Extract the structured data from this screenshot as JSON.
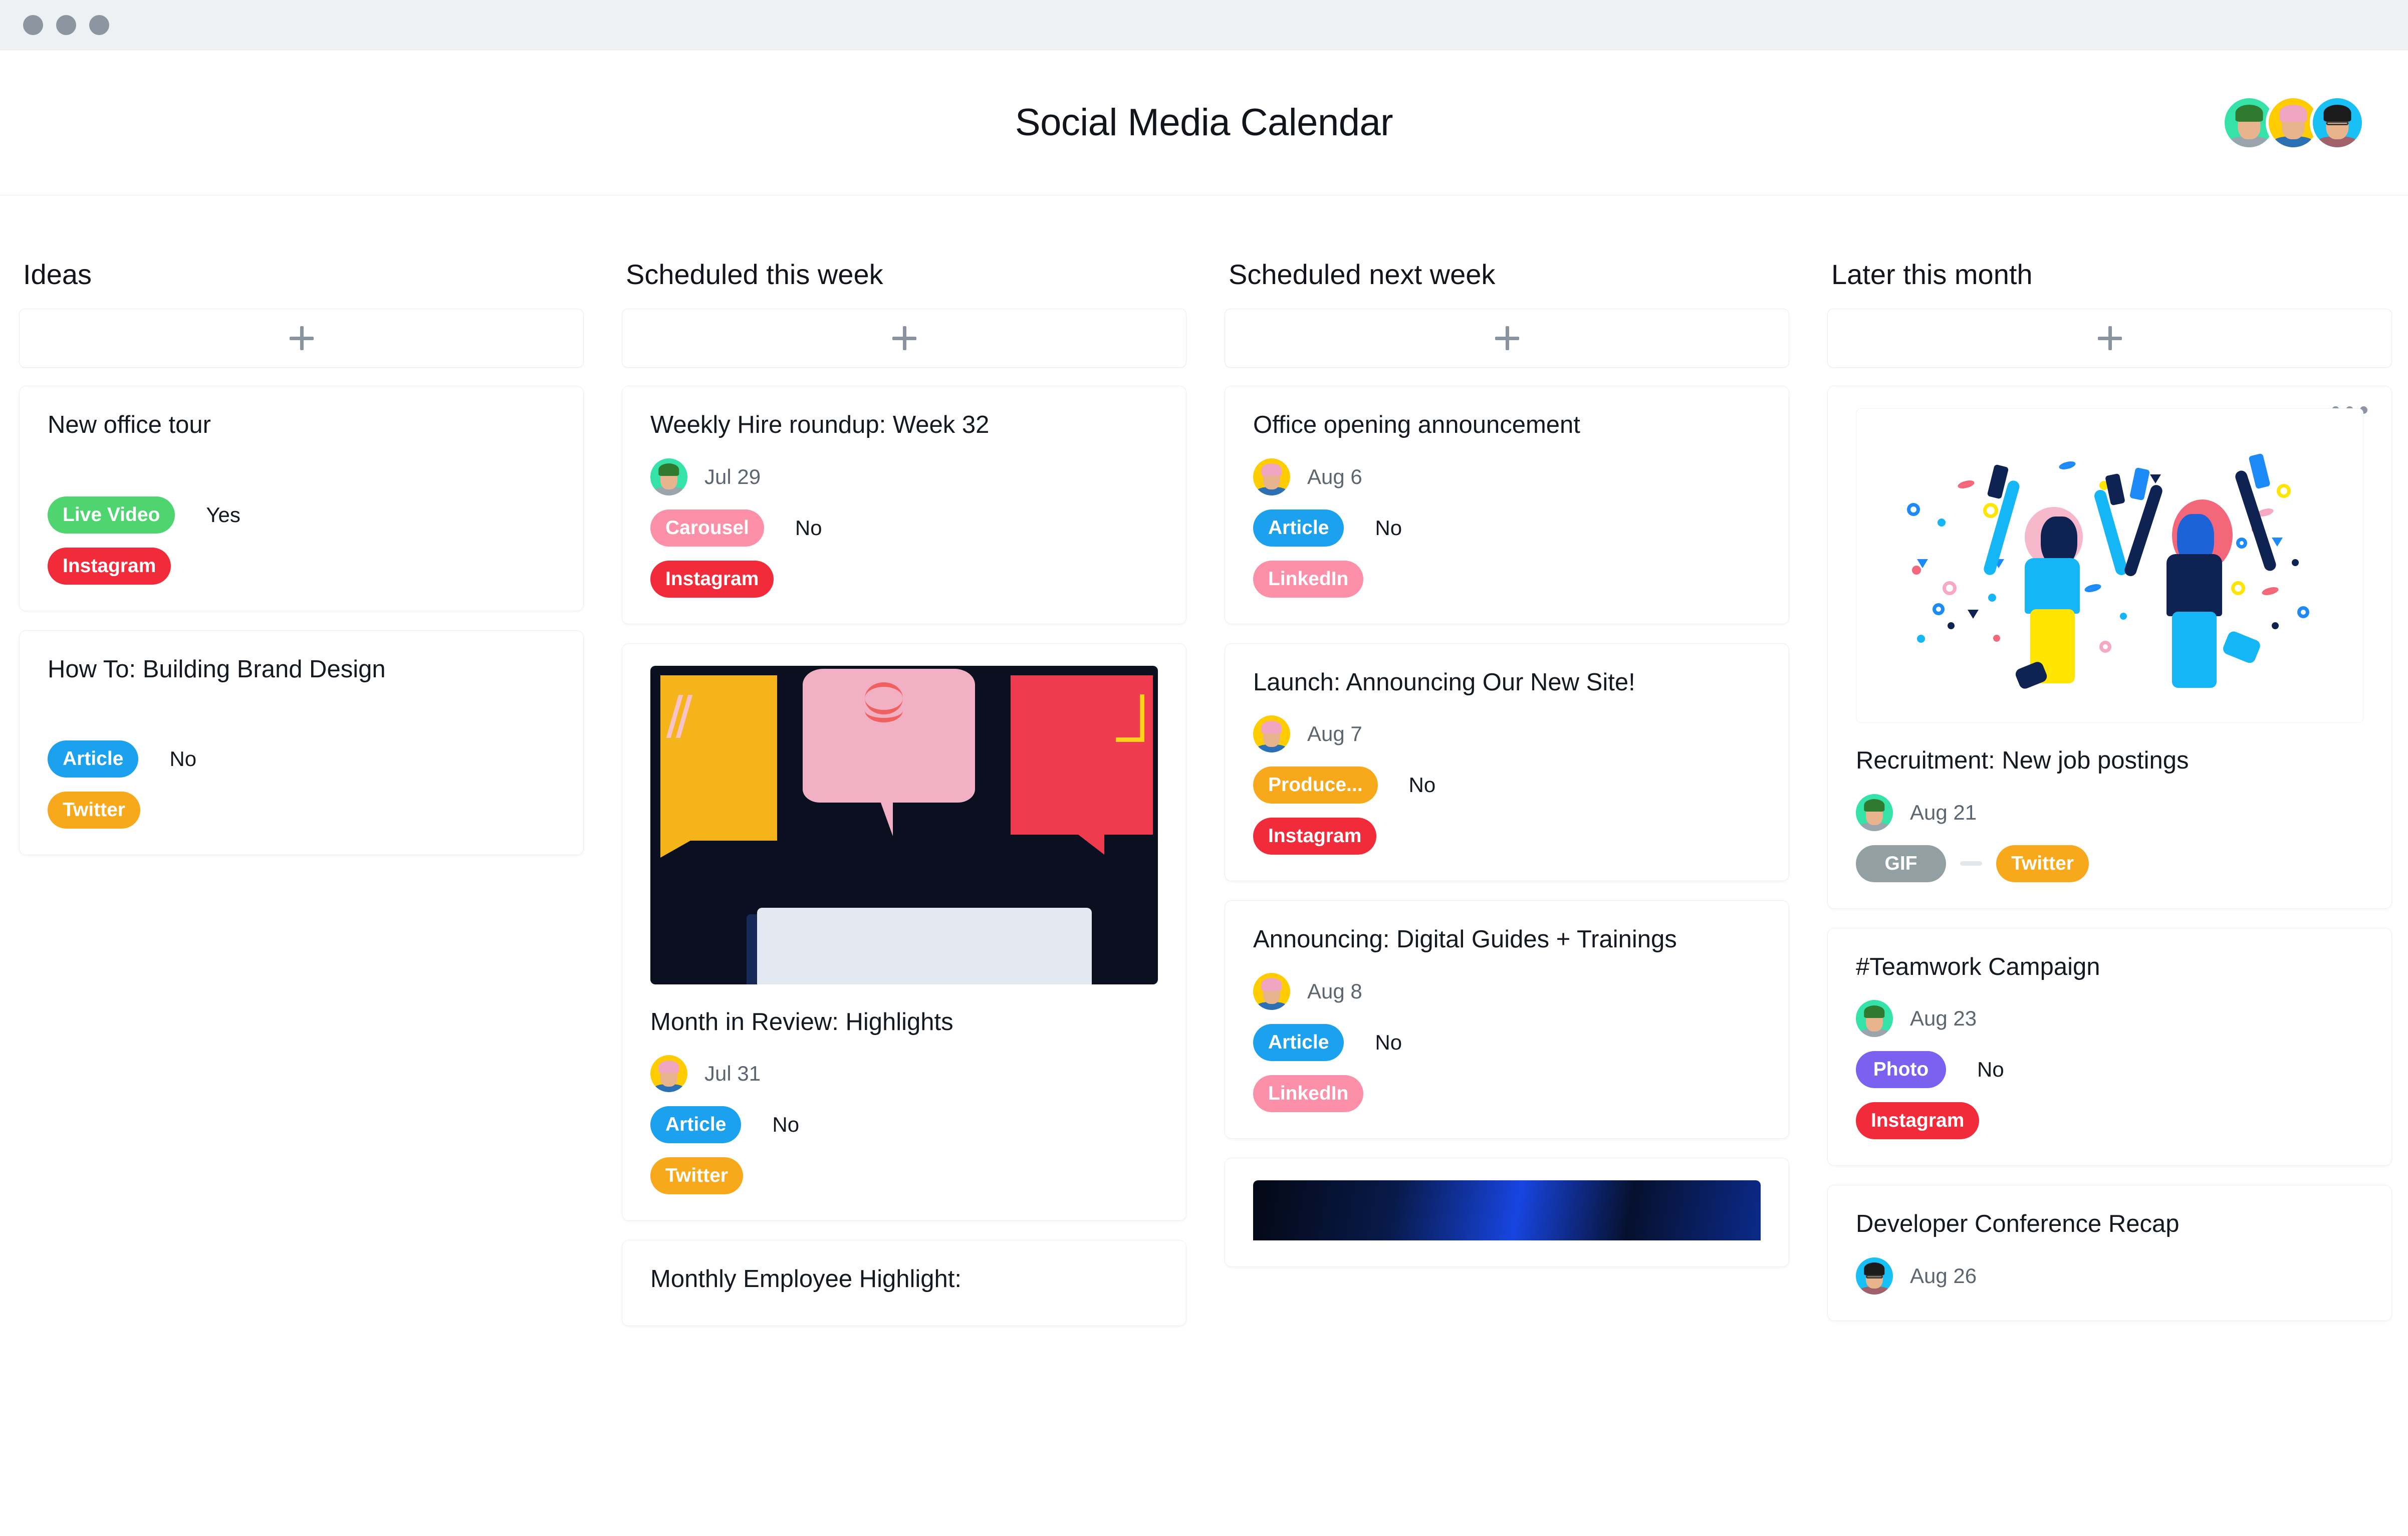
{
  "window": {
    "traffic_lights": [
      "close",
      "minimize",
      "zoom"
    ]
  },
  "header": {
    "title": "Social Media Calendar",
    "members": [
      {
        "name": "member-green",
        "bg": "#35e3a8",
        "hair": "#2f7a2f",
        "body": "#9aa4ad"
      },
      {
        "name": "member-yellow",
        "bg": "#ffcc00",
        "hair": "#f0a6c0",
        "body": "#2b6fb5"
      },
      {
        "name": "member-blue",
        "bg": "#18c0f5",
        "hair": "#1b1b1b",
        "body": "#a0616a"
      }
    ]
  },
  "colors": {
    "Live Video": "#4ed56f",
    "Instagram": "#f22b3b",
    "Article": "#1ca1ee",
    "Twitter": "#f7a91b",
    "Carousel": "#fb90a8",
    "LinkedIn": "#fb90a8",
    "Produce...": "#f7a91b",
    "Photo": "#7b61f0",
    "GIF": "#93a0a3"
  },
  "add_button_label": "+",
  "columns": [
    {
      "title": "Ideas",
      "cards": [
        {
          "title": "New office tour",
          "spacer": true,
          "tags": [
            {
              "label": "Live Video",
              "answer": "Yes"
            },
            {
              "label": "Instagram",
              "answer": ""
            }
          ]
        },
        {
          "title": "How To: Building Brand Design",
          "spacer": true,
          "tags": [
            {
              "label": "Article",
              "answer": "No"
            },
            {
              "label": "Twitter",
              "answer": ""
            }
          ]
        }
      ]
    },
    {
      "title": "Scheduled this week",
      "cards": [
        {
          "title": "Weekly Hire roundup: Week 32",
          "avatar": "member-green",
          "date": "Jul 29",
          "tags": [
            {
              "label": "Carousel",
              "answer": "No"
            },
            {
              "label": "Instagram",
              "answer": ""
            }
          ]
        },
        {
          "image": "speech-bubbles",
          "title": "Month in Review: Highlights",
          "avatar": "member-yellow",
          "date": "Jul 31",
          "tags": [
            {
              "label": "Article",
              "answer": "No"
            },
            {
              "label": "Twitter",
              "answer": ""
            }
          ]
        },
        {
          "title": "Monthly Employee Highlight:"
        }
      ]
    },
    {
      "title": "Scheduled next week",
      "cards": [
        {
          "title": "Office opening announcement",
          "avatar": "member-yellow",
          "date": "Aug 6",
          "tags": [
            {
              "label": "Article",
              "answer": "No"
            },
            {
              "label": "LinkedIn",
              "answer": ""
            }
          ]
        },
        {
          "title": "Launch: Announcing Our New Site!",
          "avatar": "member-yellow",
          "date": "Aug 7",
          "tags": [
            {
              "label": "Produce...",
              "answer": "No"
            },
            {
              "label": "Instagram",
              "answer": ""
            }
          ]
        },
        {
          "title": "Announcing: Digital Guides + Trainings",
          "avatar": "member-yellow",
          "date": "Aug 8",
          "tags": [
            {
              "label": "Article",
              "answer": "No"
            },
            {
              "label": "LinkedIn",
              "answer": ""
            }
          ]
        },
        {
          "image": "dark-blue"
        }
      ]
    },
    {
      "title": "Later this month",
      "cards": [
        {
          "image": "confetti-dancers",
          "title": "Recruitment: New job postings",
          "menu": "ellipsis",
          "avatar": "member-green",
          "date": "Aug 21",
          "inline_tags": [
            {
              "label": "GIF"
            },
            {
              "label": "Twitter"
            }
          ]
        },
        {
          "title": "#Teamwork Campaign",
          "avatar": "member-green",
          "date": "Aug 23",
          "tags": [
            {
              "label": "Photo",
              "answer": "No"
            },
            {
              "label": "Instagram",
              "answer": ""
            }
          ]
        },
        {
          "title": "Developer Conference Recap",
          "avatar": "member-blue",
          "date": "Aug 26"
        }
      ]
    }
  ]
}
